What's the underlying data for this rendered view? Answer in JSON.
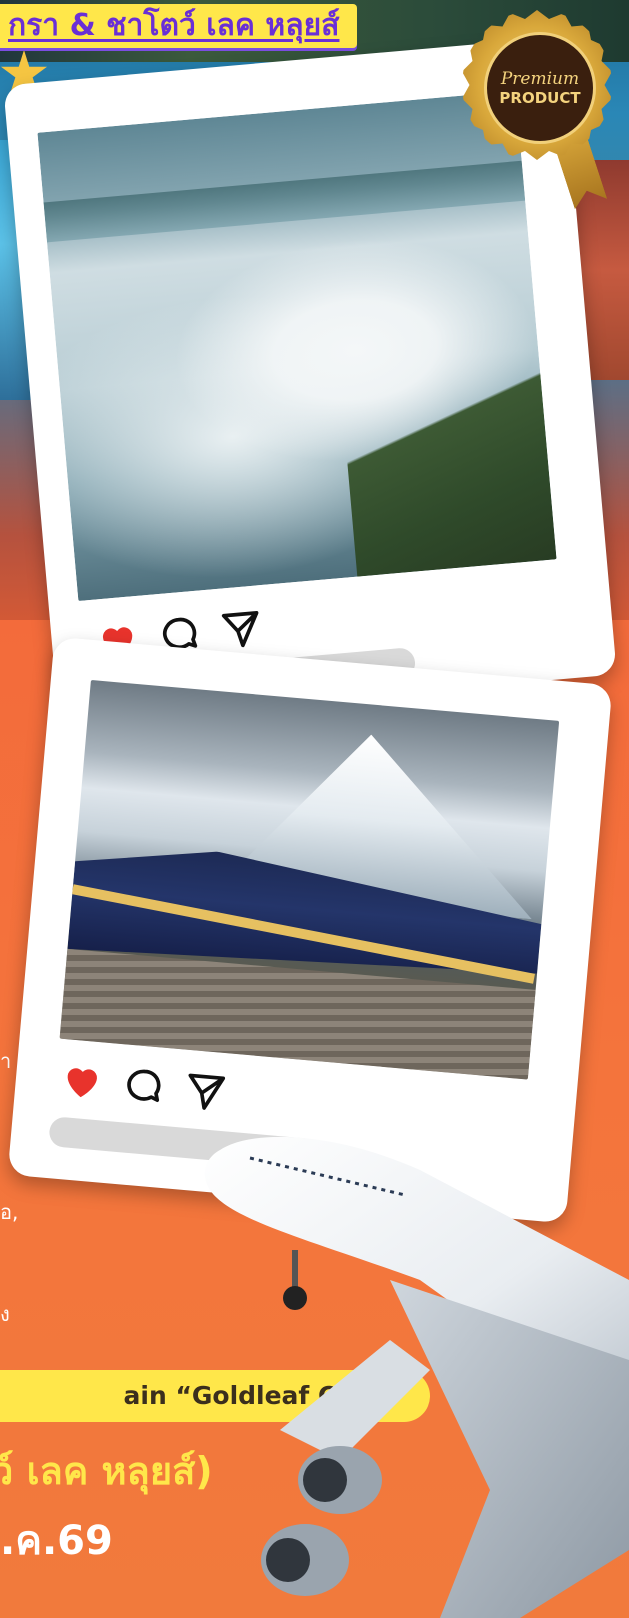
{
  "header": {
    "headline": "กรา & ชาโตว์ เลค หลุยส์"
  },
  "seal": {
    "script": "Premium",
    "label": "PRODUCT"
  },
  "cards": [
    {
      "photo": "niagara-falls-aerial-photo",
      "icons": [
        "heart-icon",
        "comment-icon",
        "send-icon"
      ]
    },
    {
      "photo": "rocky-mountaineer-train-photo",
      "icons": [
        "heart-icon",
        "comment-icon",
        "send-icon"
      ]
    }
  ],
  "side_text": {
    "line_1": "า",
    "line_2": "อ,",
    "line_3": "ง"
  },
  "banner": {
    "text": "ain “Goldleaf Class”"
  },
  "route": {
    "text": "ว์ เลค หลุยส์)"
  },
  "date": {
    "text": ".ค.69"
  },
  "colors": {
    "headline_bg": "#ffe74a",
    "headline_text": "#6a2fd6",
    "orange_bg": "#f26a3a",
    "heart": "#e8332c",
    "banner_bg": "#ffe74a",
    "route_text": "#ffe74a",
    "date_text": "#ffffff"
  }
}
